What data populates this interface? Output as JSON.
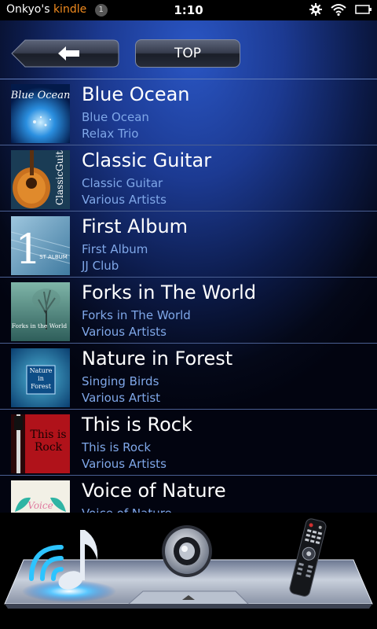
{
  "status_bar": {
    "device_name": "Onkyo's",
    "brand": "kindle",
    "notification_count": "1",
    "time": "1:10",
    "icons": [
      "settings-icon",
      "wifi-icon",
      "battery-icon"
    ]
  },
  "toolbar": {
    "back_icon": "back-arrow-icon",
    "top_label": "TOP"
  },
  "albums": [
    {
      "title": "Blue Ocean",
      "album": "Blue Ocean",
      "artist": "Relax Trio",
      "cover_text": "Blue Ocean"
    },
    {
      "title": "Classic Guitar",
      "album": "Classic Guitar",
      "artist": "Various Artists",
      "cover_text": "ClassicGuitar"
    },
    {
      "title": "First Album",
      "album": "First Album",
      "artist": "JJ Club",
      "cover_text": "1",
      "cover_subtext": "ST ALBUM"
    },
    {
      "title": "Forks in The World",
      "album": "Forks in The World",
      "artist": "Various Artists",
      "cover_text": "Forks in the World"
    },
    {
      "title": "Nature in Forest",
      "album": "Singing Birds",
      "artist": "Various Artist",
      "cover_text": "Nature in Forest"
    },
    {
      "title": "This is Rock",
      "album": "This is Rock",
      "artist": "Various Artists",
      "cover_text": "This is Rock"
    },
    {
      "title": "Voice of Nature",
      "album": "Voice of Nature",
      "artist": "",
      "cover_text": "Voice"
    }
  ],
  "bottom_nav": [
    "music-note-wifi-icon",
    "speaker-icon",
    "remote-control-icon"
  ],
  "colors": {
    "accent_blue": "#7fa7e8",
    "kindle_orange": "#f08a1e",
    "background_blue": "#1c3a92",
    "divider": "#4a5f92"
  }
}
